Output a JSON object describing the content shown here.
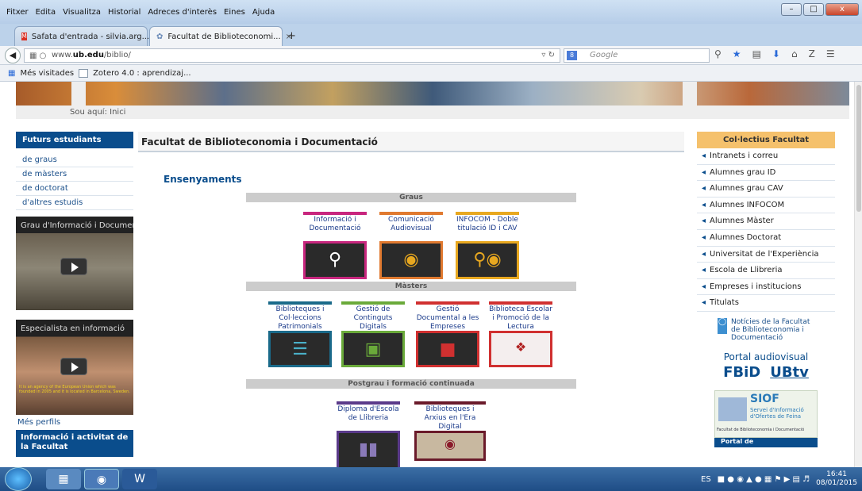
{
  "menu": [
    "Fitxer",
    "Edita",
    "Visualitza",
    "Historial",
    "Adreces d'interès",
    "Eines",
    "Ajuda"
  ],
  "window_buttons": {
    "minimize": "–",
    "maximize": "□",
    "close": "x"
  },
  "tabs": [
    {
      "label": "Safata d'entrada - silvia.arg...",
      "close": "×",
      "icon": "gmail-icon"
    },
    {
      "label": "Facultat de Biblioteconomi...",
      "close": "×",
      "icon": "ub-favicon-icon"
    }
  ],
  "new_tab": "+",
  "url": {
    "prefix": "www.",
    "domain": "ub.edu",
    "path": "/biblio/"
  },
  "search": {
    "engine_icon": "8",
    "placeholder": "Google"
  },
  "bookmarks": [
    "Més visitades",
    "Zotero 4.0 : aprendizaj..."
  ],
  "breadcrumb": "Sou aquí: Inici",
  "left": {
    "head": "Futurs estudiants",
    "links": [
      "de graus",
      "de màsters",
      "de doctorat",
      "d'altres estudis"
    ],
    "video1": "Grau d'Informació i Documentació",
    "video2": "Especialista en informació",
    "video2_caption": "It is an agency of the European Union which was founded in 2005 and it is located in Barcelona, Sweden.",
    "mes_perfils": "Més perfils",
    "info_head": "Informació i activitat de la Facultat"
  },
  "center": {
    "title": "Facultat de Biblioteconomia i Documentació",
    "section": "Ensenyaments",
    "groups": [
      {
        "label": "Graus",
        "tiles": [
          {
            "label": "Informació i Documentació",
            "color": "#c8267e",
            "icon": "search-person-icon"
          },
          {
            "label": "Comunicació Audiovisual",
            "color": "#e07a30",
            "icon": "camera-icon"
          },
          {
            "label": "INFOCOM - Doble titulació ID i CAV",
            "color": "#e8a820",
            "icon": "search-camera-icon"
          }
        ]
      },
      {
        "label": "Màsters",
        "tiles": [
          {
            "label": "Biblioteques i Col·leccions Patrimonials",
            "color": "#1a6a8a",
            "icon": "books-icon"
          },
          {
            "label": "Gestió de Continguts Digitals",
            "color": "#6aaa3a",
            "icon": "touch-doc-icon"
          },
          {
            "label": "Gestió Documental a les Empreses",
            "color": "#d03030",
            "icon": "chat-icon"
          },
          {
            "label": "Biblioteca Escolar i Promoció de la Lectura",
            "color": "#d03030",
            "icon": "reading-logo-icon"
          }
        ]
      },
      {
        "label": "Postgrau i formació continuada",
        "tiles": [
          {
            "label": "Diploma d'Escola de Llibreria",
            "color": "#5a3a8a",
            "icon": "bookshelf-icon"
          },
          {
            "label": "Biblioteques i Arxius en l'Era Digital",
            "color": "#6a1a2a",
            "icon": "ub-logo-icon"
          }
        ]
      }
    ]
  },
  "right": {
    "head": "Col·lectius Facultat",
    "links": [
      "Intranets i correu",
      "Alumnes grau ID",
      "Alumnes grau CAV",
      "Alumnes INFOCOM",
      "Alumnes Màster",
      "Alumnes Doctorat",
      "Universitat de l'Experiència",
      "Escola de Llibreria",
      "Empreses i institucions",
      "Titulats"
    ],
    "noticies": "Notícies de la Facultat de Biblioteconomia i Documentació",
    "portal": "Portal audiovisual",
    "fbid": "FBiD",
    "ubtv": "UBtv",
    "siof_title": "SIOF",
    "siof_sub": "Servei d'Informació d'Ofertes de Feina",
    "siof_foot": "Facultat de Biblioteconomia i Documentació",
    "portal_do": "Portal de"
  },
  "taskbar": {
    "lang": "ES",
    "time": "16:41",
    "date": "08/01/2015"
  }
}
